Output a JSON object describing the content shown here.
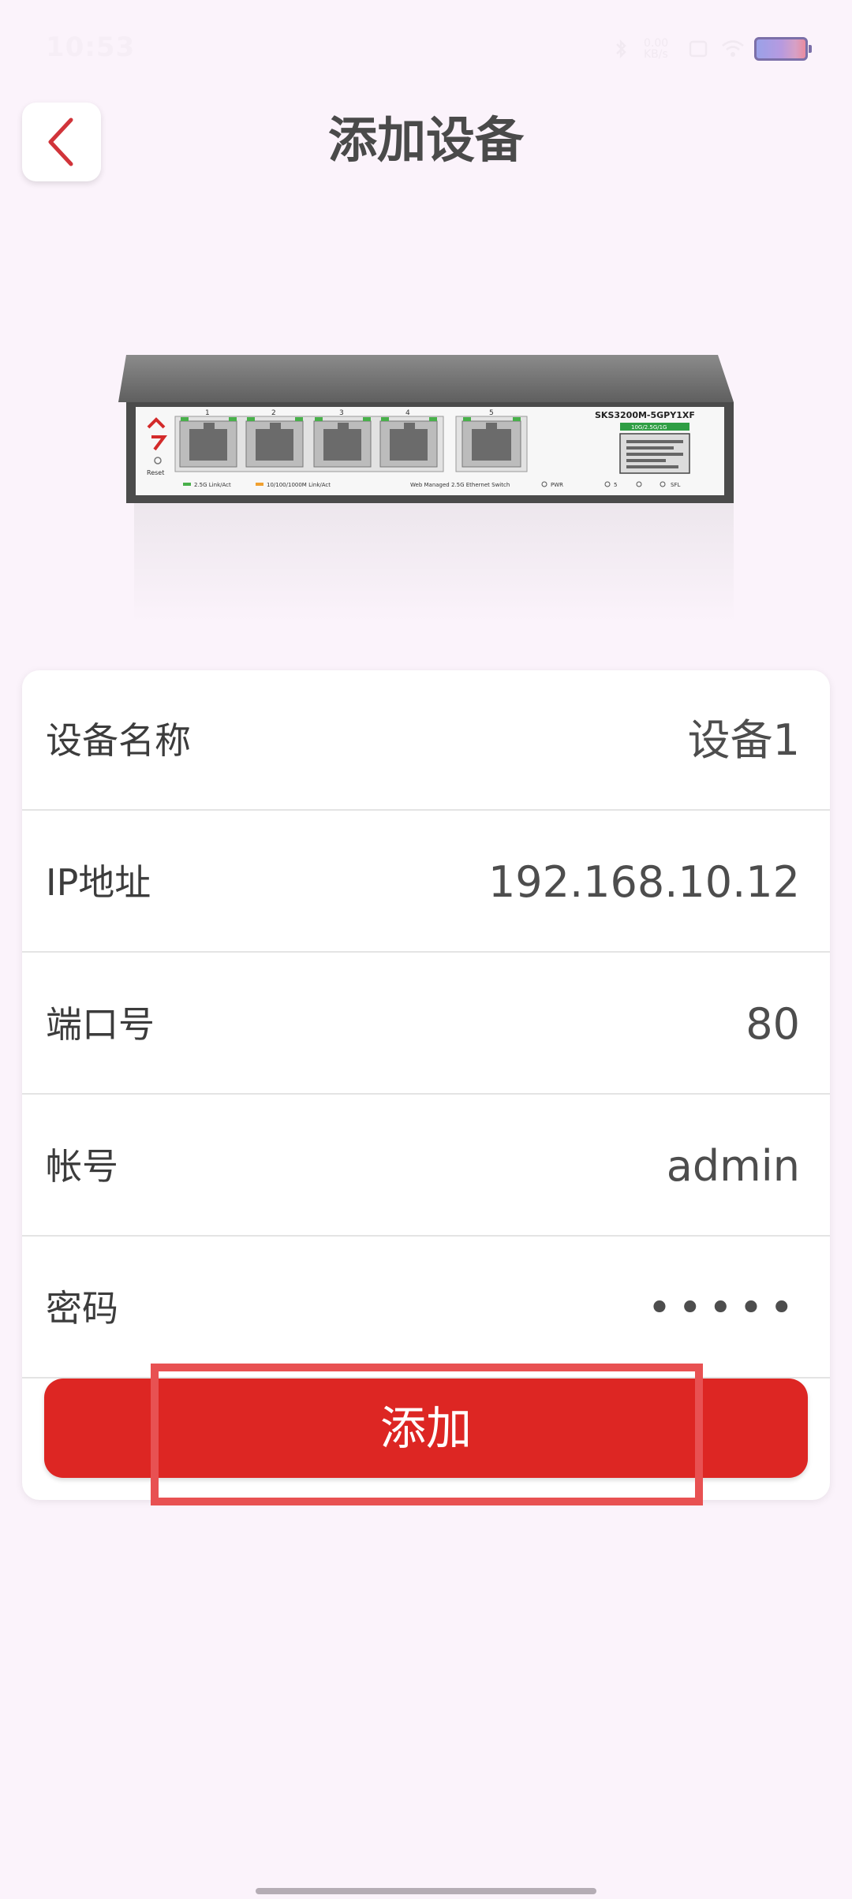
{
  "status_bar": {
    "time": "10:53",
    "network_label": "0.00\nKB/s",
    "icons": [
      "bluetooth-icon",
      "network-speed-icon",
      "notification-icon",
      "wifi-icon",
      "battery-icon"
    ]
  },
  "header": {
    "title": "添加设备",
    "back_icon": "chevron-left-icon"
  },
  "device": {
    "model": "SKS3200M-5GPY1XF",
    "ports": [
      "1",
      "2",
      "3",
      "4",
      "5"
    ],
    "legend_1": "2.5G Link/Act",
    "legend_2": "10/100/1000M Link/Act",
    "legend_3": "Web Managed 2.5G Ethernet Switch",
    "reset_label": "Reset",
    "label_tag": "10G/2.5G/1G",
    "indicators": [
      "PWR",
      "5",
      "SFL"
    ]
  },
  "form": {
    "rows": [
      {
        "label": "设备名称",
        "value": "设备1"
      },
      {
        "label": "IP地址",
        "value": "192.168.10.12"
      },
      {
        "label": "端口号",
        "value": "80"
      },
      {
        "label": "帐号",
        "value": "admin"
      },
      {
        "label": "密码",
        "value": "•••••"
      }
    ],
    "add_button_label": "添加"
  },
  "colors": {
    "accent": "#dd2623",
    "background": "#fbf3fb",
    "highlight": "#e85152"
  }
}
